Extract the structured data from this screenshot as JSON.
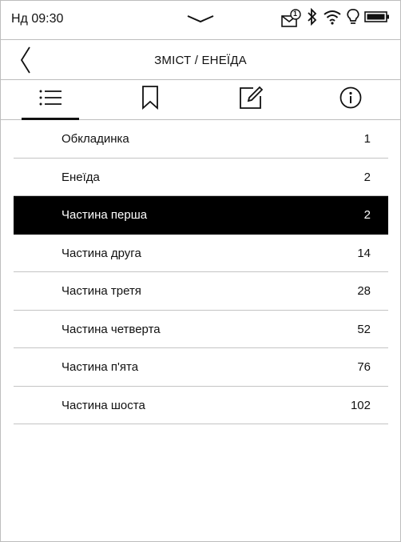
{
  "status_bar": {
    "time": "Нд 09:30",
    "notification_count": "1"
  },
  "header": {
    "title": "ЗМІСТ / ЕНЕЇДА"
  },
  "tabs": [
    {
      "icon": "list-icon",
      "active": true
    },
    {
      "icon": "bookmark-icon",
      "active": false
    },
    {
      "icon": "note-edit-icon",
      "active": false
    },
    {
      "icon": "info-icon",
      "active": false
    }
  ],
  "toc": {
    "items": [
      {
        "label": "Обкладинка",
        "page": "1",
        "selected": false
      },
      {
        "label": "Енеїда",
        "page": "2",
        "selected": false
      },
      {
        "label": "Частина перша",
        "page": "2",
        "selected": true
      },
      {
        "label": "Частина друга",
        "page": "14",
        "selected": false
      },
      {
        "label": "Частина третя",
        "page": "28",
        "selected": false
      },
      {
        "label": "Частина четверта",
        "page": "52",
        "selected": false
      },
      {
        "label": "Частина п'ята",
        "page": "76",
        "selected": false
      },
      {
        "label": "Частина шоста",
        "page": "102",
        "selected": false
      }
    ]
  }
}
